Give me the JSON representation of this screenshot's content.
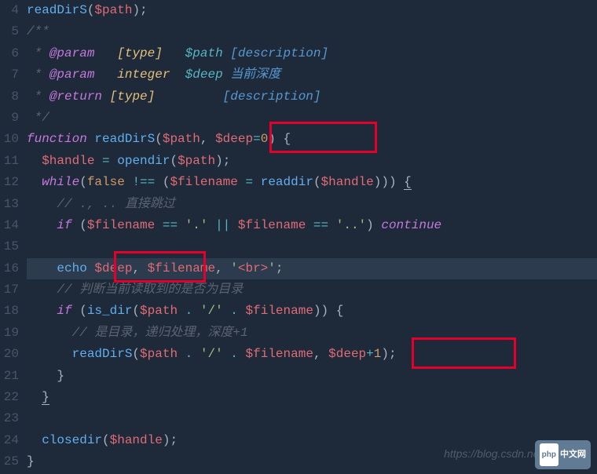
{
  "startLine": 4,
  "lines": [
    {
      "num": 4,
      "frags": [
        {
          "c": "fn",
          "t": "readDirS"
        },
        {
          "c": "punct",
          "t": "("
        },
        {
          "c": "var",
          "t": "$path"
        },
        {
          "c": "punct",
          "t": ");"
        }
      ]
    },
    {
      "num": 5,
      "frags": [
        {
          "c": "doc",
          "t": "/**"
        }
      ]
    },
    {
      "num": 6,
      "frags": [
        {
          "c": "doc",
          "t": " * "
        },
        {
          "c": "doctag",
          "t": "@param"
        },
        {
          "c": "doc",
          "t": "   "
        },
        {
          "c": "doctype",
          "t": "[type]"
        },
        {
          "c": "doc",
          "t": "   "
        },
        {
          "c": "docvar",
          "t": "$path"
        },
        {
          "c": "doc",
          "t": " "
        },
        {
          "c": "docdesc",
          "t": "[description]"
        }
      ]
    },
    {
      "num": 7,
      "frags": [
        {
          "c": "doc",
          "t": " * "
        },
        {
          "c": "doctag",
          "t": "@param"
        },
        {
          "c": "doc",
          "t": "   "
        },
        {
          "c": "doctype",
          "t": "integer"
        },
        {
          "c": "doc",
          "t": "  "
        },
        {
          "c": "docvar",
          "t": "$deep"
        },
        {
          "c": "doc",
          "t": " "
        },
        {
          "c": "docdesc",
          "t": "当前深度"
        }
      ]
    },
    {
      "num": 8,
      "frags": [
        {
          "c": "doc",
          "t": " * "
        },
        {
          "c": "doctag",
          "t": "@return"
        },
        {
          "c": "doc",
          "t": " "
        },
        {
          "c": "doctype",
          "t": "[type]"
        },
        {
          "c": "doc",
          "t": "         "
        },
        {
          "c": "docdesc",
          "t": "[description]"
        }
      ]
    },
    {
      "num": 9,
      "frags": [
        {
          "c": "doc",
          "t": " */"
        }
      ]
    },
    {
      "num": 10,
      "frags": [
        {
          "c": "kw",
          "t": "function"
        },
        {
          "c": "punct",
          "t": " "
        },
        {
          "c": "fn",
          "t": "readDirS"
        },
        {
          "c": "punct",
          "t": "("
        },
        {
          "c": "var",
          "t": "$path"
        },
        {
          "c": "punct",
          "t": ", "
        },
        {
          "c": "var",
          "t": "$deep"
        },
        {
          "c": "op",
          "t": "="
        },
        {
          "c": "num",
          "t": "0"
        },
        {
          "c": "punct",
          "t": ") {"
        }
      ]
    },
    {
      "num": 11,
      "frags": [
        {
          "c": "punct",
          "t": "  "
        },
        {
          "c": "var",
          "t": "$handle"
        },
        {
          "c": "punct",
          "t": " "
        },
        {
          "c": "op",
          "t": "="
        },
        {
          "c": "punct",
          "t": " "
        },
        {
          "c": "fn",
          "t": "opendir"
        },
        {
          "c": "punct",
          "t": "("
        },
        {
          "c": "var",
          "t": "$path"
        },
        {
          "c": "punct",
          "t": ");"
        }
      ]
    },
    {
      "num": 12,
      "frags": [
        {
          "c": "punct",
          "t": "  "
        },
        {
          "c": "kw",
          "t": "while"
        },
        {
          "c": "punct",
          "t": "("
        },
        {
          "c": "num",
          "t": "false"
        },
        {
          "c": "punct",
          "t": " "
        },
        {
          "c": "op",
          "t": "!=="
        },
        {
          "c": "punct",
          "t": " ("
        },
        {
          "c": "var",
          "t": "$filename"
        },
        {
          "c": "punct",
          "t": " "
        },
        {
          "c": "op",
          "t": "="
        },
        {
          "c": "punct",
          "t": " "
        },
        {
          "c": "fn",
          "t": "readdir"
        },
        {
          "c": "punct",
          "t": "("
        },
        {
          "c": "var",
          "t": "$handle"
        },
        {
          "c": "punct",
          "t": "))) "
        },
        {
          "c": "punct underline",
          "t": "{"
        }
      ]
    },
    {
      "num": 13,
      "frags": [
        {
          "c": "punct",
          "t": "    "
        },
        {
          "c": "cmt",
          "t": "// ., .. 直接跳过"
        }
      ]
    },
    {
      "num": 14,
      "frags": [
        {
          "c": "punct",
          "t": "    "
        },
        {
          "c": "kw",
          "t": "if"
        },
        {
          "c": "punct",
          "t": " ("
        },
        {
          "c": "var",
          "t": "$filename"
        },
        {
          "c": "punct",
          "t": " "
        },
        {
          "c": "op",
          "t": "=="
        },
        {
          "c": "punct",
          "t": " "
        },
        {
          "c": "str",
          "t": "'.'"
        },
        {
          "c": "punct",
          "t": " "
        },
        {
          "c": "op",
          "t": "||"
        },
        {
          "c": "punct",
          "t": " "
        },
        {
          "c": "var",
          "t": "$filename"
        },
        {
          "c": "punct",
          "t": " "
        },
        {
          "c": "op",
          "t": "=="
        },
        {
          "c": "punct",
          "t": " "
        },
        {
          "c": "str",
          "t": "'..'"
        },
        {
          "c": "punct",
          "t": ") "
        },
        {
          "c": "kw",
          "t": "continue"
        }
      ]
    },
    {
      "num": 15,
      "frags": [
        {
          "c": "punct",
          "t": " "
        }
      ]
    },
    {
      "num": 16,
      "hl": true,
      "frags": [
        {
          "c": "punct",
          "t": "    "
        },
        {
          "c": "fn",
          "t": "echo"
        },
        {
          "c": "punct",
          "t": " "
        },
        {
          "c": "var",
          "t": "$deep"
        },
        {
          "c": "punct",
          "t": ", "
        },
        {
          "c": "var",
          "t": "$filename"
        },
        {
          "c": "punct",
          "t": ", "
        },
        {
          "c": "str",
          "t": "'"
        },
        {
          "c": "tag",
          "t": "<br>"
        },
        {
          "c": "str",
          "t": "'"
        },
        {
          "c": "punct",
          "t": ";"
        }
      ]
    },
    {
      "num": 17,
      "frags": [
        {
          "c": "punct",
          "t": "    "
        },
        {
          "c": "cmt",
          "t": "// 判断当前读取到的是否为目录"
        }
      ]
    },
    {
      "num": 18,
      "frags": [
        {
          "c": "punct",
          "t": "    "
        },
        {
          "c": "kw",
          "t": "if"
        },
        {
          "c": "punct",
          "t": " ("
        },
        {
          "c": "fn",
          "t": "is_dir"
        },
        {
          "c": "punct",
          "t": "("
        },
        {
          "c": "var",
          "t": "$path"
        },
        {
          "c": "punct",
          "t": " "
        },
        {
          "c": "op",
          "t": "."
        },
        {
          "c": "punct",
          "t": " "
        },
        {
          "c": "str",
          "t": "'/'"
        },
        {
          "c": "punct",
          "t": " "
        },
        {
          "c": "op",
          "t": "."
        },
        {
          "c": "punct",
          "t": " "
        },
        {
          "c": "var",
          "t": "$filename"
        },
        {
          "c": "punct",
          "t": ")) {"
        }
      ]
    },
    {
      "num": 19,
      "frags": [
        {
          "c": "punct",
          "t": "      "
        },
        {
          "c": "cmt",
          "t": "// 是目录，递归处理，深度+1"
        }
      ]
    },
    {
      "num": 20,
      "frags": [
        {
          "c": "punct",
          "t": "      "
        },
        {
          "c": "fn",
          "t": "readDirS"
        },
        {
          "c": "punct",
          "t": "("
        },
        {
          "c": "var",
          "t": "$path"
        },
        {
          "c": "punct",
          "t": " "
        },
        {
          "c": "op",
          "t": "."
        },
        {
          "c": "punct",
          "t": " "
        },
        {
          "c": "str",
          "t": "'/'"
        },
        {
          "c": "punct",
          "t": " "
        },
        {
          "c": "op",
          "t": "."
        },
        {
          "c": "punct",
          "t": " "
        },
        {
          "c": "var",
          "t": "$filename"
        },
        {
          "c": "punct",
          "t": ", "
        },
        {
          "c": "var",
          "t": "$deep"
        },
        {
          "c": "op",
          "t": "+"
        },
        {
          "c": "num",
          "t": "1"
        },
        {
          "c": "punct",
          "t": ");"
        }
      ]
    },
    {
      "num": 21,
      "frags": [
        {
          "c": "punct",
          "t": "    }"
        }
      ]
    },
    {
      "num": 22,
      "frags": [
        {
          "c": "punct",
          "t": "  "
        },
        {
          "c": "punct underline",
          "t": "}"
        }
      ]
    },
    {
      "num": 23,
      "frags": [
        {
          "c": "punct",
          "t": " "
        }
      ]
    },
    {
      "num": 24,
      "frags": [
        {
          "c": "punct",
          "t": "  "
        },
        {
          "c": "fn",
          "t": "closedir"
        },
        {
          "c": "punct",
          "t": "("
        },
        {
          "c": "var",
          "t": "$handle"
        },
        {
          "c": "punct",
          "t": ");"
        }
      ]
    },
    {
      "num": 25,
      "frags": [
        {
          "c": "punct",
          "t": "}"
        }
      ]
    }
  ],
  "watermark": "https://blog.csdn.net/change_",
  "logo": {
    "prefix": "php",
    "suffix": "中文网"
  }
}
